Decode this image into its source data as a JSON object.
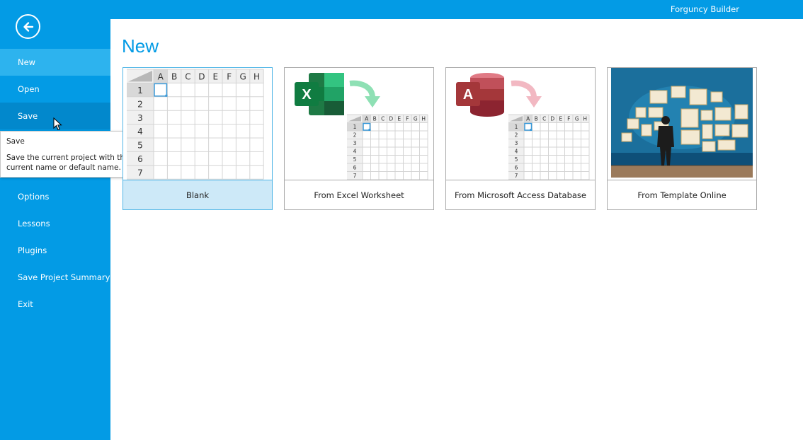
{
  "app": {
    "title": "Forguncy Builder"
  },
  "sidebar": {
    "back_icon": "arrow-left-circle-icon",
    "items": [
      {
        "label": "New"
      },
      {
        "label": "Open"
      },
      {
        "label": "Save"
      },
      {
        "label": "Options"
      },
      {
        "label": "Lessons"
      },
      {
        "label": "Plugins"
      },
      {
        "label": "Save Project Summary"
      },
      {
        "label": "Exit"
      }
    ],
    "selected": "New",
    "hovered": "Save"
  },
  "tooltip": {
    "title": "Save",
    "description": "Save the current project with the current name or default name."
  },
  "main": {
    "title": "New",
    "cards": [
      {
        "label": "Blank"
      },
      {
        "label": "From Excel Worksheet"
      },
      {
        "label": "From Microsoft Access Database"
      },
      {
        "label": "From Template Online"
      }
    ],
    "grid": {
      "columns": [
        "A",
        "B",
        "C",
        "D",
        "E",
        "F",
        "G",
        "H"
      ],
      "rows": [
        "1",
        "2",
        "3",
        "4",
        "5",
        "6",
        "7"
      ]
    }
  },
  "colors": {
    "accent": "#039be5",
    "selected_item": "#2db3ee",
    "hover_item": "#0288cc",
    "card_selected_bg": "#cde9f8",
    "excel_green": "#1e7a45",
    "access_red": "#a4373a"
  }
}
